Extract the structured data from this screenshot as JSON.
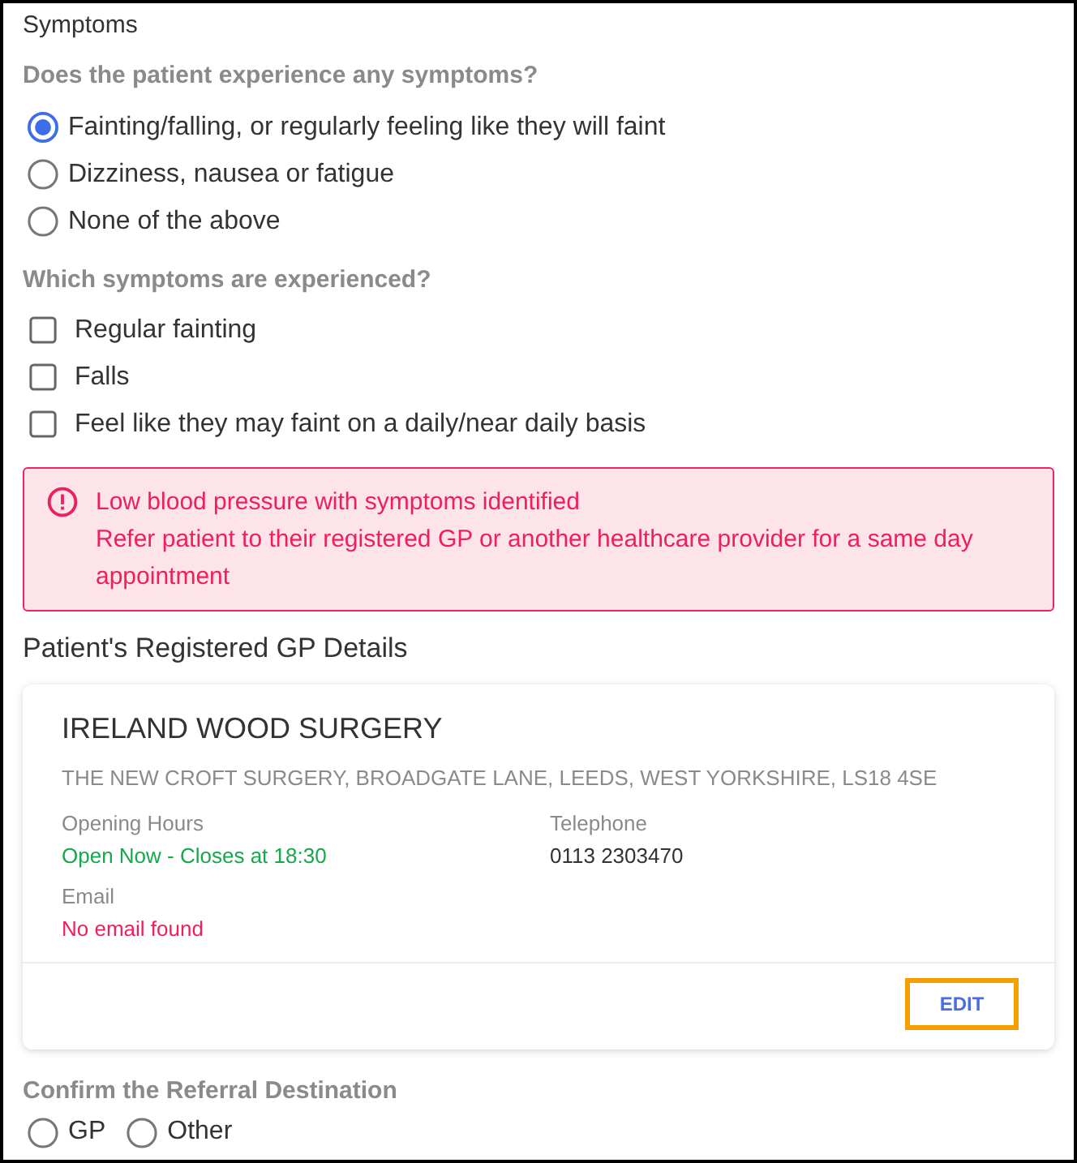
{
  "section_title": "Symptoms",
  "symptom_question": {
    "label": "Does the patient experience any symptoms?",
    "options": [
      {
        "label": "Fainting/falling, or regularly feeling like they will faint",
        "selected": true
      },
      {
        "label": "Dizziness, nausea or fatigue",
        "selected": false
      },
      {
        "label": "None of the above",
        "selected": false
      }
    ]
  },
  "symptoms_checklist": {
    "label": "Which symptoms are experienced?",
    "items": [
      {
        "label": "Regular fainting",
        "checked": false
      },
      {
        "label": "Falls",
        "checked": false
      },
      {
        "label": "Feel like they may faint on a daily/near daily basis",
        "checked": false
      }
    ]
  },
  "alert": {
    "title": "Low blood pressure with symptoms identified",
    "message": "Refer patient to their registered GP or another healthcare provider for a same day appointment"
  },
  "gp_details": {
    "heading": "Patient's Registered GP Details",
    "practice_name": "IRELAND WOOD SURGERY",
    "address": "THE NEW CROFT SURGERY, BROADGATE LANE, LEEDS, WEST YORKSHIRE, LS18 4SE",
    "fields": [
      {
        "label": "Opening Hours",
        "value": "Open Now - Closes at 18:30",
        "kind": "open"
      },
      {
        "label": "Telephone",
        "value": "0113 2303470",
        "kind": "plain"
      },
      {
        "label": "Email",
        "value": "No email found",
        "kind": "missing"
      }
    ],
    "edit_button": {
      "label": "EDIT",
      "highlighted": true
    }
  },
  "referral_destination": {
    "label": "Confirm the Referral Destination",
    "options": [
      {
        "label": "GP",
        "selected": false
      },
      {
        "label": "Other",
        "selected": false
      }
    ]
  }
}
